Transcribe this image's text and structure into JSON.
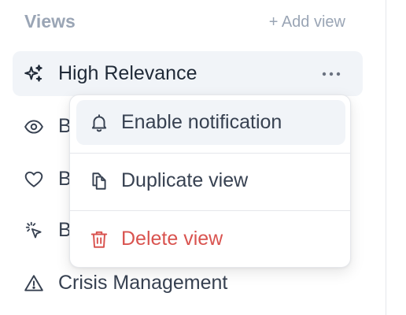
{
  "views": {
    "title": "Views",
    "add_view_label": "+ Add view",
    "items": [
      {
        "label": "High Relevance",
        "icon": "sparkles-icon",
        "active": true
      },
      {
        "label": "B",
        "icon": "eye-icon"
      },
      {
        "label": "B",
        "icon": "heart-icon"
      },
      {
        "label": "B",
        "icon": "click-cursor-icon"
      },
      {
        "label": "Crisis Management",
        "icon": "warning-triangle-icon"
      }
    ],
    "more_icon": "ellipsis-icon"
  },
  "context_menu": {
    "items": [
      {
        "label": "Enable notification",
        "icon": "bell-icon"
      },
      {
        "label": "Duplicate view",
        "icon": "copy-icon"
      },
      {
        "label": "Delete view",
        "icon": "trash-icon"
      }
    ]
  },
  "colors": {
    "active_bg": "#f1f4f8",
    "danger": "#d9534f",
    "muted_header": "#9aa5b5"
  }
}
